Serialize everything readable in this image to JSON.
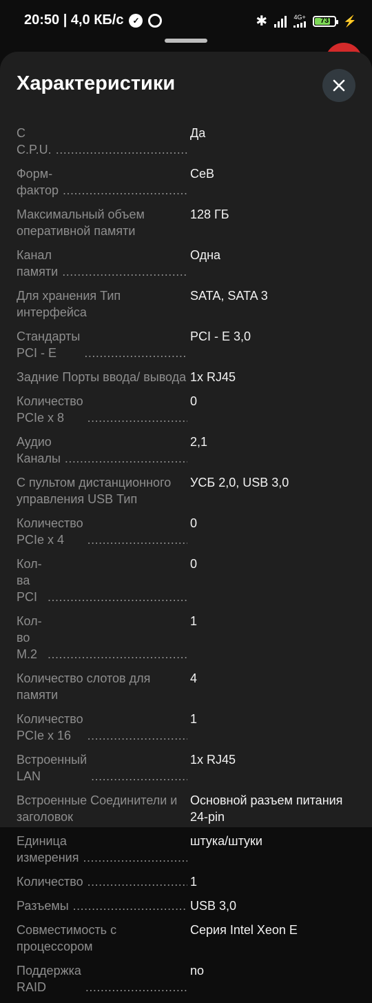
{
  "status": {
    "time_speed": "20:50 | 4,0 КБ/с",
    "network": "4G+",
    "battery": "73"
  },
  "sheet": {
    "title": "Характеристики"
  },
  "specs": [
    {
      "label": "C C.P.U.",
      "value": "Да",
      "dots": true
    },
    {
      "label": "Форм-фактор",
      "value": "CeB",
      "dots": true
    },
    {
      "label": "Максимальный объем оперативной памяти",
      "value": "128 ГБ",
      "dots": false
    },
    {
      "label": "Канал памяти",
      "value": "Одна",
      "dots": true
    },
    {
      "label": "Для хранения Тип интерфейса",
      "value": "SATA, SATA 3",
      "dots": false
    },
    {
      "label": "Стандарты PCI - E",
      "value": "PCI - E 3,0",
      "dots": true
    },
    {
      "label": "Задние Порты ввода/ вывода",
      "value": "1x RJ45",
      "dots": false
    },
    {
      "label": "Количество PCIe x 8",
      "value": "0",
      "dots": true
    },
    {
      "label": "Аудио Каналы",
      "value": "2,1",
      "dots": true
    },
    {
      "label": "С пультом дистанционного управления USB Тип",
      "value": "УСБ 2,0, USB 3,0",
      "dots": false
    },
    {
      "label": "Количество PCIe x 4",
      "value": "0",
      "dots": true
    },
    {
      "label": "Кол-ва PCI",
      "value": "0",
      "dots": true
    },
    {
      "label": "Кол-во M.2",
      "value": "1",
      "dots": true
    },
    {
      "label": "Количество слотов для памяти",
      "value": "4",
      "dots": false
    },
    {
      "label": "Количество PCIe x 16",
      "value": "1",
      "dots": true
    },
    {
      "label": "Встроенный LAN",
      "value": "1x RJ45",
      "dots": true
    },
    {
      "label": "Встроенные Соединители и заголовок",
      "value": "Основной разъем питания 24-pin",
      "dots": false
    },
    {
      "label": "Единица измерения",
      "value": "штука/штуки",
      "dots": true
    },
    {
      "label": "Количество",
      "value": "1",
      "dots": true
    },
    {
      "label": "Разъемы",
      "value": "USB 3,0",
      "dots": true
    },
    {
      "label": "Совместимость с процессором",
      "value": "Серия Intel Xeon E",
      "dots": false
    },
    {
      "label": "Поддержка RAID",
      "value": "no",
      "dots": true
    }
  ],
  "colors": {
    "background": "#0d0d0d",
    "sheet": "#1f1f1f",
    "label": "#8e8e8e",
    "value": "#f2f2f2",
    "battery_fill": "#7ed957"
  }
}
